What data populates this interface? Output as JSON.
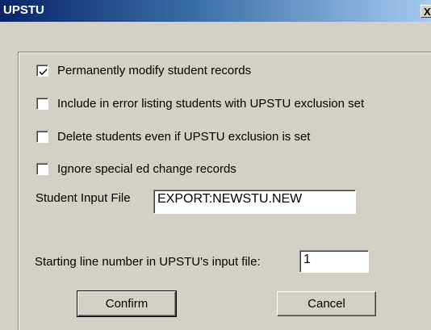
{
  "window": {
    "title": "UPSTU",
    "close_glyph": "X"
  },
  "options": [
    {
      "label": "Permanently modify student records",
      "checked": true
    },
    {
      "label": "Include in error listing students with UPSTU exclusion set",
      "checked": false
    },
    {
      "label": "Delete students even if UPSTU exclusion is set",
      "checked": false
    },
    {
      "label": "Ignore special ed change records",
      "checked": false
    }
  ],
  "student_input": {
    "label": "Student Input File",
    "value": "EXPORT:NEWSTU.NEW"
  },
  "start_line": {
    "label": "Starting line number in UPSTU's input file:",
    "value": "1"
  },
  "buttons": {
    "confirm": "Confirm",
    "cancel": "Cancel"
  }
}
